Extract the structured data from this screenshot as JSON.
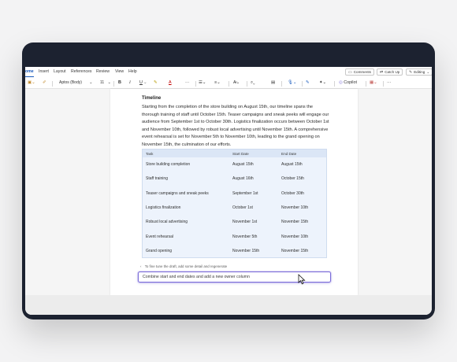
{
  "ribbon": {
    "tabs": [
      "ome",
      "Insert",
      "Layout",
      "References",
      "Review",
      "View",
      "Help"
    ],
    "comments_label": "Comments",
    "catchup_label": "Catch Up",
    "editing_label": "Editing"
  },
  "toolbar": {
    "font_name": "Aptos (Body)",
    "font_size": "11",
    "bold": "B",
    "italic": "I",
    "underline": "U",
    "more": "···",
    "copilot_label": "Copilot"
  },
  "document": {
    "heading": "Timeline",
    "paragraph": "Starting from the completion of the store building on August 15th, our timeline spans the thorough training of staff until October 15th. Teaser campaigns and sneak peeks will engage our audience from September 1st to October 30th. Logistics finalization occurs between October 1st and November 10th, followed by robust local advertising until November 15th. A comprehensive event rehearsal is set for November 5th to November 10th, leading to the grand opening on November 15th, the culmination of our efforts.",
    "table": {
      "headers": [
        "Task",
        "Start Date",
        "End Date"
      ],
      "rows": [
        [
          "Store building completion",
          "August 15th",
          "August 15th"
        ],
        [
          "Staff training",
          "August 16th",
          "October 15th"
        ],
        [
          "Teaser campaigns and sneak peeks",
          "September 1st",
          "October 30th"
        ],
        [
          "Logistics finalization",
          "October 1st",
          "November 10th"
        ],
        [
          "Robust local advertising",
          "November 1st",
          "November 15th"
        ],
        [
          "Event rehearsal",
          "November 5th",
          "November 10th"
        ],
        [
          "Grand opening",
          "November 15th",
          "November 15th"
        ]
      ]
    }
  },
  "copilot": {
    "hint": "To fine tune the draft, add some detail and regenerate",
    "prompt_value": "Combine start and end dates and add a new owner column"
  },
  "colors": {
    "accent": "#185abd",
    "copilot_border": "#7b6cd9",
    "table_fill": "#edf3fc",
    "device_frame": "#1c2230"
  }
}
